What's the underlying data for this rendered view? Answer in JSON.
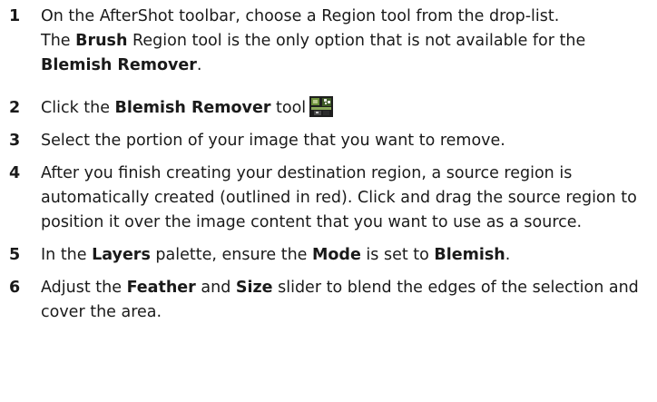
{
  "steps": [
    {
      "number": "1",
      "text": "On the AfterShot toolbar, choose a Region tool from the drop-list.",
      "note": {
        "pre": "The ",
        "b1": "Brush",
        "mid": " Region tool is the only option that is not available for the ",
        "b2": "Blemish Remover",
        "post": "."
      }
    },
    {
      "number": "2",
      "pre": "Click the ",
      "b1": "Blemish Remover",
      "post": " tool",
      "icon": "blemish-remover-tool-icon"
    },
    {
      "number": "3",
      "text": "Select the portion of your image that you want to remove."
    },
    {
      "number": "4",
      "text": "After you finish creating your destination region, a source region is automatically created (outlined in red). Click and drag the source region to position it over the image content that you want to use as a source."
    },
    {
      "number": "5",
      "pre": "In the ",
      "b1": "Layers",
      "mid1": " palette, ensure the ",
      "b2": "Mode",
      "mid2": " is set to ",
      "b3": "Blemish",
      "post": "."
    },
    {
      "number": "6",
      "pre": "Adjust the ",
      "b1": "Feather",
      "mid": " and ",
      "b2": "Size",
      "post": " slider to blend the edges of the selection and cover the area."
    }
  ],
  "colors": {
    "text": "#1a1a1a",
    "icon_dark": "#1e1e1e",
    "icon_green": "#6b8f3a"
  }
}
